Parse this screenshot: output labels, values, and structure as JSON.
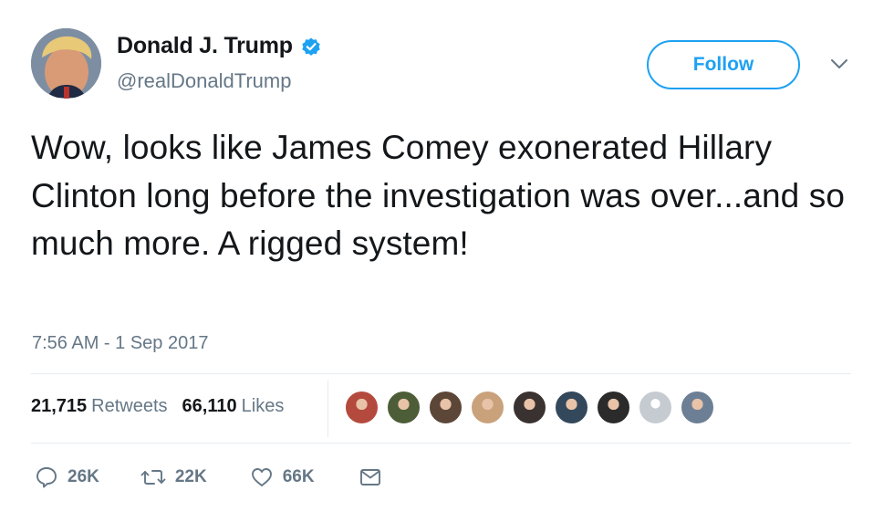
{
  "user": {
    "name": "Donald J. Trump",
    "handle": "@realDonaldTrump",
    "verified": true
  },
  "follow_label": "Follow",
  "tweet": {
    "text": "Wow, looks like James Comey exonerated Hillary Clinton long before the investigation was over...and so much more. A rigged system!",
    "timestamp": "7:56 AM - 1 Sep 2017"
  },
  "stats": {
    "retweets_count": "21,715",
    "retweets_label": "Retweets",
    "likes_count": "66,110",
    "likes_label": "Likes"
  },
  "liked_by_avatars": [
    {
      "color": "#b44a3d"
    },
    {
      "color": "#4d5d37"
    },
    {
      "color": "#5c4637"
    },
    {
      "color": "#c9a27c"
    },
    {
      "color": "#3a3230"
    },
    {
      "color": "#34485c"
    },
    {
      "color": "#2b2b2b"
    },
    {
      "color": "#c5cbd1"
    },
    {
      "color": "#6d7f95"
    }
  ],
  "actions": {
    "reply_count": "26K",
    "retweet_count": "22K",
    "like_count": "66K"
  },
  "colors": {
    "accent": "#1da1f2",
    "secondary_text": "#657786",
    "divider": "#e6ecf0"
  }
}
